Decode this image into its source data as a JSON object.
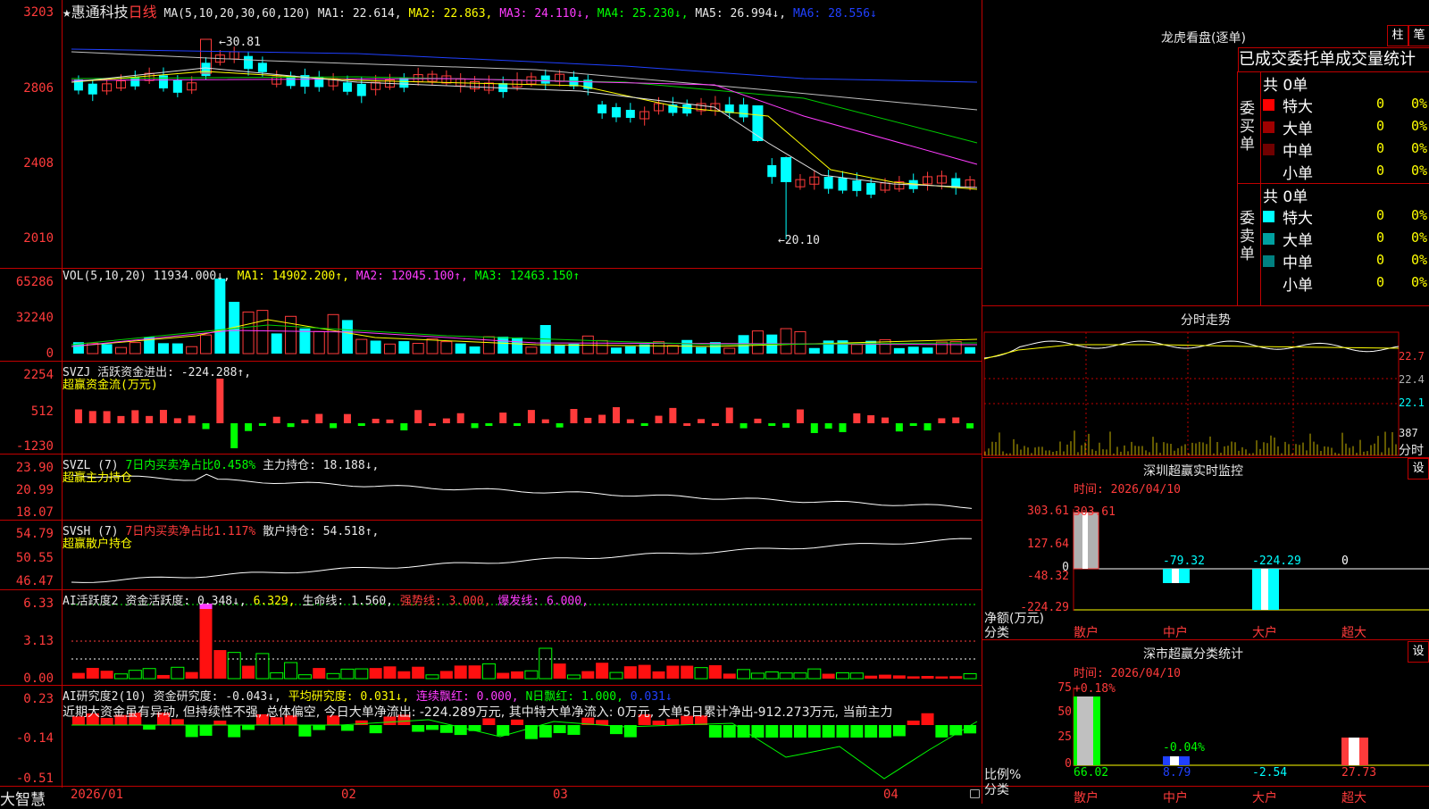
{
  "title": {
    "star": "★",
    "stock_name": "惠通科技",
    "period": "日线",
    "ma_label": "MA(5,10,20,30,60,120)",
    "ma1": "MA1: 22.614,",
    "ma2": "MA2: 22.863,",
    "ma3": "MA3: 24.110↓,",
    "ma4": "MA4: 25.230↓,",
    "ma5": "MA5: 26.994↓,",
    "ma6": "MA6: 28.556↓"
  },
  "price_axis": [
    "3203",
    "2806",
    "2408",
    "2010"
  ],
  "price_marks": {
    "high": "30.81",
    "low": "20.10"
  },
  "vol": {
    "label": "VOL(5,10,20)",
    "value": "11934.000↓,",
    "ma1": "MA1: 14902.200↑,",
    "ma2": "MA2: 12045.100↑,",
    "ma3": "MA3: 12463.150↑",
    "axis": [
      "65286",
      "32240",
      "0"
    ]
  },
  "svzj": {
    "label": "SVZJ",
    "title": "活跃资金进出: -224.288↑,",
    "sub": "超赢资金流(万元)",
    "axis": [
      "2254",
      "512",
      "-1230"
    ]
  },
  "svzl": {
    "label": "SVZL (7)",
    "ratio": "7日内买卖净占比0.458%",
    "hold": "主力持仓: 18.188↓,",
    "sub": "超赢主力持仓",
    "axis": [
      "23.90",
      "20.99",
      "18.07"
    ]
  },
  "svsh": {
    "label": "SVSH (7)",
    "ratio": "7日内买卖净占比1.117%",
    "hold": "散户持仓: 54.518↑,",
    "sub": "超赢散户持仓",
    "axis": [
      "54.79",
      "50.55",
      "46.47"
    ]
  },
  "ai_act": {
    "label": "AI活跃度2",
    "v1": "资金活跃度: 0.348↓,",
    "v2": "6.329,",
    "v3": "生命线: 1.560,",
    "v4": "强势线: 3.000,",
    "v5": "爆发线: 6.000,",
    "axis": [
      "6.33",
      "3.13",
      "0.00"
    ]
  },
  "ai_res": {
    "label": "AI研究度2(10)",
    "v1": "资金研究度: -0.043↓,",
    "v2": "平均研究度: 0.031↓,",
    "v3": "连续飘红: 0.000,",
    "v4": "N日飘红: 1.000,",
    "v5": "0.031↓",
    "comment": "近期大资金虽有异动, 但持续性不强, 总体偏空, 今日大单净流出: -224.289万元, 其中特大单净流入: 0万元, 大单5日累计净出-912.273万元, 当前主力",
    "axis": [
      "0.23",
      "-0.14",
      "-0.51"
    ]
  },
  "bottom": {
    "brand": "大智慧",
    "dates": [
      "2026/01",
      "02",
      "03",
      "04"
    ]
  },
  "longhu": {
    "title": "龙虎看盘(逐单)",
    "btn_zhu": "柱",
    "btn_bi": "笔",
    "tab_text": "已成交委托单成交量统计",
    "buy_group": "委买单",
    "sell_group": "委卖单",
    "buy_total": "共 0单",
    "sell_total": "共 0单",
    "buy_rows": [
      {
        "name": "特大",
        "val": "0",
        "pct": "0%",
        "color": "#ff0000"
      },
      {
        "name": "大单",
        "val": "0",
        "pct": "0%",
        "color": "#a00000"
      },
      {
        "name": "中单",
        "val": "0",
        "pct": "0%",
        "color": "#700000"
      },
      {
        "name": "小单",
        "val": "0",
        "pct": "0%",
        "color": "#000000"
      }
    ],
    "sell_rows": [
      {
        "name": "特大",
        "val": "0",
        "pct": "0%",
        "color": "#00ffff"
      },
      {
        "name": "大单",
        "val": "0",
        "pct": "0%",
        "color": "#00a0a0"
      },
      {
        "name": "中单",
        "val": "0",
        "pct": "0%",
        "color": "#008080"
      },
      {
        "name": "小单",
        "val": "0",
        "pct": "0%",
        "color": "#000000"
      }
    ]
  },
  "fenshi": {
    "title": "分时走势",
    "axis": [
      "22.7",
      "22.4",
      "22.1"
    ],
    "vol_axis": [
      "387",
      "分时"
    ]
  },
  "monitor": {
    "title": "深圳超赢实时监控",
    "btn": "设",
    "time": "时间: 2026/04/10",
    "axis": [
      "303.61",
      "127.64",
      "0",
      "-48.32",
      "-224.29"
    ],
    "ylabel": "净额(万元)",
    "xlabel": "分类",
    "bars": [
      {
        "name": "散户",
        "value": "303.61"
      },
      {
        "name": "中户",
        "value": "-79.32"
      },
      {
        "name": "大户",
        "value": "-224.29"
      },
      {
        "name": "超大",
        "value": "0"
      }
    ]
  },
  "classify": {
    "title": "深市超赢分类统计",
    "btn": "设",
    "time": "时间: 2026/04/10",
    "axis": [
      "75",
      "50",
      "25",
      "0"
    ],
    "ylabel": "比例%",
    "xlabel": "分类",
    "bars": [
      {
        "name": "散户",
        "value": "66.02",
        "delta": "+0.18%"
      },
      {
        "name": "中户",
        "value": "8.79",
        "delta": "-0.04%"
      },
      {
        "name": "大户",
        "value": "-2.54",
        "delta": ""
      },
      {
        "name": "超大",
        "value": "27.73",
        "delta": ""
      }
    ]
  }
}
